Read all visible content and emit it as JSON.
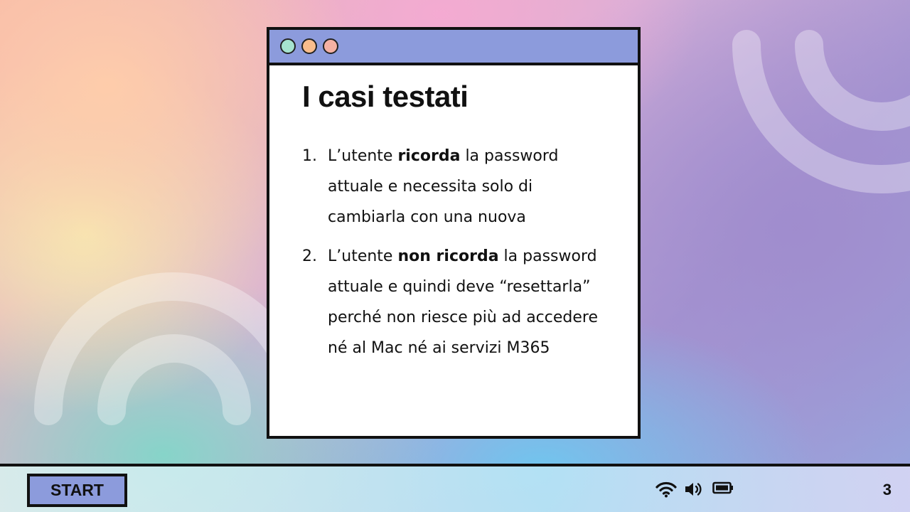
{
  "slide": {
    "title": "I casi testati",
    "items": [
      {
        "number": "1.",
        "before": "L’utente ",
        "bold": "ricorda",
        "after": " la password attuale e necessita solo di cambiarla con una nuova"
      },
      {
        "number": "2.",
        "before": "L’utente ",
        "bold": "non ricorda",
        "after": " la password attuale e quindi deve “resettarla” perché non riesce più ad accedere né al Mac né ai servizi M365"
      }
    ]
  },
  "window": {
    "dots": [
      "#a6e3cf",
      "#f9bd8c",
      "#f5b1a3"
    ],
    "titlebar_color": "#8c9bdc"
  },
  "taskbar": {
    "start_label": "START",
    "icons": [
      "wifi-icon",
      "volume-icon",
      "battery-icon"
    ],
    "page_number": "3"
  }
}
